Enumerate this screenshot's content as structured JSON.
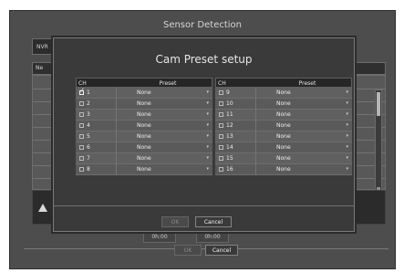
{
  "background": {
    "title": "Sensor Detection",
    "tab": "NVR",
    "header_label": "Ne",
    "bottom": {
      "field_a": "0h:00",
      "field_b": "0h:00",
      "ok": "OK",
      "cancel": "Cancel"
    }
  },
  "modal": {
    "title": "Cam Preset setup",
    "headers": {
      "ch": "CH",
      "preset": "Preset"
    },
    "left_rows": [
      {
        "ch": "1",
        "preset": "None",
        "checked": true
      },
      {
        "ch": "2",
        "preset": "None",
        "checked": false
      },
      {
        "ch": "3",
        "preset": "None",
        "checked": false
      },
      {
        "ch": "4",
        "preset": "None",
        "checked": false
      },
      {
        "ch": "5",
        "preset": "None",
        "checked": false
      },
      {
        "ch": "6",
        "preset": "None",
        "checked": false
      },
      {
        "ch": "7",
        "preset": "None",
        "checked": false
      },
      {
        "ch": "8",
        "preset": "None",
        "checked": false
      }
    ],
    "right_rows": [
      {
        "ch": "9",
        "preset": "None",
        "checked": false
      },
      {
        "ch": "10",
        "preset": "None",
        "checked": false
      },
      {
        "ch": "11",
        "preset": "None",
        "checked": false
      },
      {
        "ch": "12",
        "preset": "None",
        "checked": false
      },
      {
        "ch": "13",
        "preset": "None",
        "checked": false
      },
      {
        "ch": "14",
        "preset": "None",
        "checked": false
      },
      {
        "ch": "15",
        "preset": "None",
        "checked": false
      },
      {
        "ch": "16",
        "preset": "None",
        "checked": false
      }
    ],
    "buttons": {
      "ok": "OK",
      "cancel": "Cancel"
    }
  },
  "icons": {
    "warning": "warning-icon",
    "checkbox": "checkbox-icon",
    "dropdown": "chevron-down-icon"
  }
}
